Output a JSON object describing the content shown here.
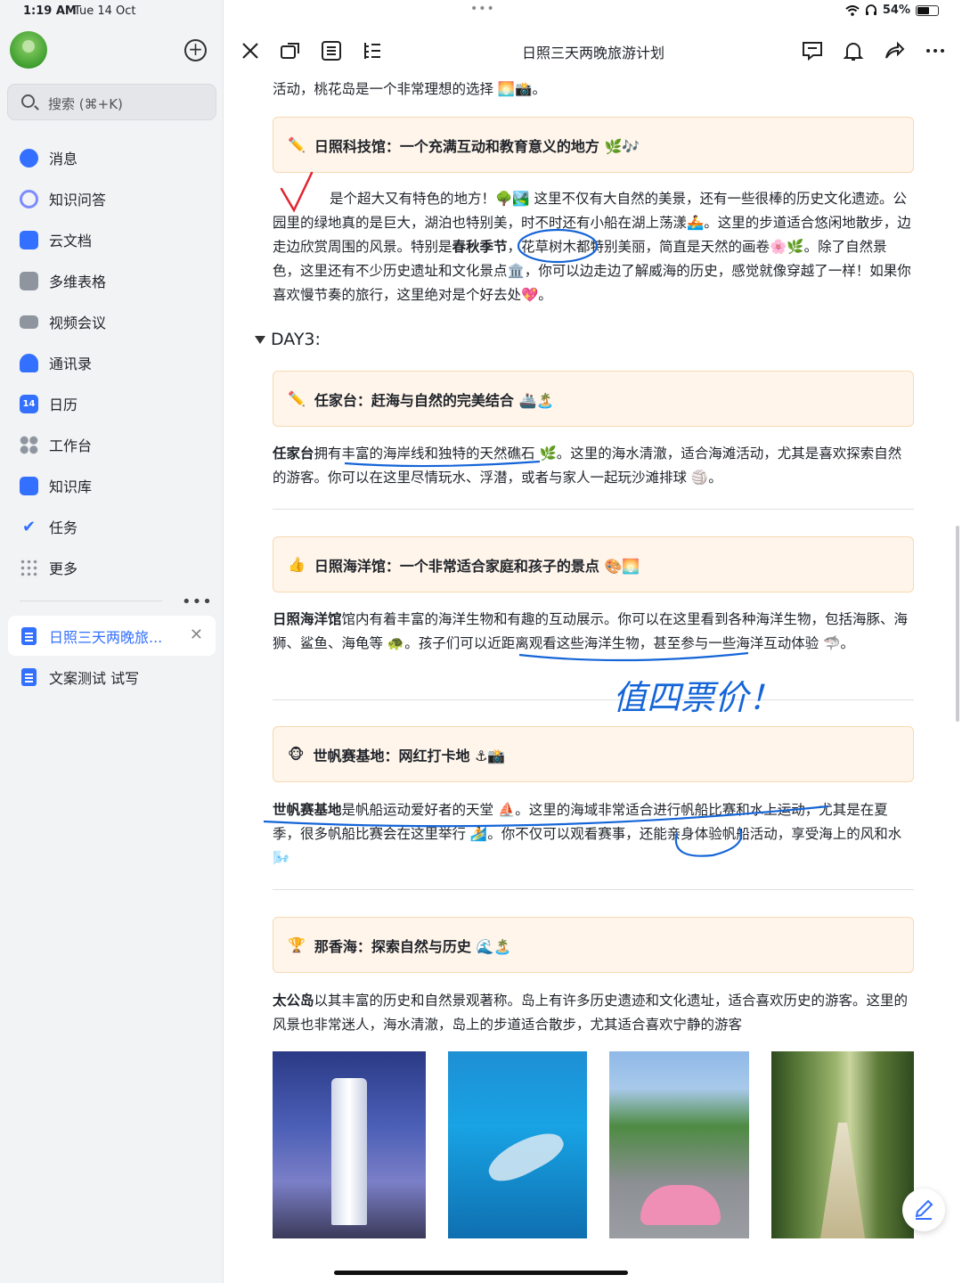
{
  "status_bar": {
    "time": "1:19 AM",
    "date": "Tue 14 Oct",
    "battery": "54%",
    "more": "•••"
  },
  "sidebar": {
    "search_placeholder": "搜索 (⌘+K)",
    "nav": [
      {
        "label": "消息",
        "icon": "message-icon",
        "color": "#3370ff"
      },
      {
        "label": "知识问答",
        "icon": "knowledge-qa-icon",
        "color": "#6b7cff"
      },
      {
        "label": "云文档",
        "icon": "cloud-docs-icon",
        "color": "#3370ff"
      },
      {
        "label": "多维表格",
        "icon": "base-table-icon",
        "color": "#8f959e"
      },
      {
        "label": "视频会议",
        "icon": "video-meeting-icon",
        "color": "#8f959e"
      },
      {
        "label": "通讯录",
        "icon": "contacts-icon",
        "color": "#3370ff"
      },
      {
        "label": "日历",
        "icon": "calendar-icon",
        "color": "#3370ff",
        "badge": "14"
      },
      {
        "label": "工作台",
        "icon": "workplace-icon",
        "color": "#8f959e"
      },
      {
        "label": "知识库",
        "icon": "wiki-icon",
        "color": "#3370ff"
      },
      {
        "label": "任务",
        "icon": "task-icon",
        "color": "#3370ff"
      },
      {
        "label": "更多",
        "icon": "more-grid-icon",
        "color": "#8f959e"
      }
    ],
    "docs": [
      {
        "label": "日照三天两晚旅..."
      },
      {
        "label": "文案测试 试写"
      }
    ]
  },
  "topbar": {
    "title": "日照三天两晚旅游计划"
  },
  "doc": {
    "p0": "活动，桃花岛是一个非常理想的选择 🌅📸。",
    "c1": {
      "emoji": "✏️",
      "text": "日照科技馆：一个充满互动和教育意义的地方 🌿🎶"
    },
    "p1": "是个超大又有特色的地方！🌳🏞️ 这里不仅有大自然的美景，还有一些很棒的历史文化遗迹。公园里的绿地真的是巨大，湖泊也特别美，时不时还有小船在湖上荡漾🚣。这里的步道适合悠闲地散步，边走边欣赏周围的风景。特别是",
    "p1_bold": "春秋季节",
    "p1_tail": "，花草树木都特别美丽，简直是天然的画卷🌸🌿。除了自然景色，这里还有不少历史遗址和文化景点🏛️，你可以边走边了解威海的历史，感觉就像穿越了一样！如果你喜欢慢节奏的旅行，这里绝对是个好去处💖。",
    "day3": "DAY3:",
    "c2": {
      "emoji": "✏️",
      "text": "任家台：赶海与自然的完美结合 🚢🏝️"
    },
    "p2_bold": "任家台",
    "p2": "拥有丰富的海岸线和独特的天然礁石 🌿。这里的海水清澈，适合海滩活动，尤其是喜欢探索自然的游客。你可以在这里尽情玩水、浮潜，或者与家人一起玩沙滩排球 🏐。",
    "c3": {
      "emoji": "👍",
      "text": "日照海洋馆：一个非常适合家庭和孩子的景点 🎨🌅"
    },
    "p3_bold": "日照海洋馆",
    "p3": "馆内有着丰富的海洋生物和有趣的互动展示。你可以在这里看到各种海洋生物，包括海豚、海狮、鲨鱼、海龟等 🐢。孩子们可以近距离观看这些海洋生物，甚至参与一些海洋互动体验 🦈。",
    "handwritten_note": "值四票价！",
    "c4": {
      "emoji": "🐵",
      "text": "世帆赛基地：网红打卡地 ⚓📸"
    },
    "p4_bold": "世帆赛基地",
    "p4": "是帆船运动爱好者的天堂 ⛵。这里的海域非常适合进行帆船比赛和水上运动，尤其是在夏季，很多帆船比赛会在这里举行 🏄。你不仅可以观看赛事，还能亲身体验帆船活动，享受海上的风和水 🌬️",
    "c5": {
      "emoji": "🏆",
      "text": "那香海：探索自然与历史 🌊🏝️"
    },
    "p5_bold": "太公岛",
    "p5": "以其丰富的历史和自然景观著称。岛上有许多历史遗迹和文化遗址，适合喜欢历史的游客。这里的风景也非常迷人，海水清澈，岛上的步道适合散步，尤其适合喜欢宁静的游客"
  },
  "colors": {
    "accent": "#3370ff",
    "callout_bg": "#fff5eb",
    "callout_border": "#f7d9b4",
    "ink": "#1565d8",
    "check": "#e0262e"
  }
}
